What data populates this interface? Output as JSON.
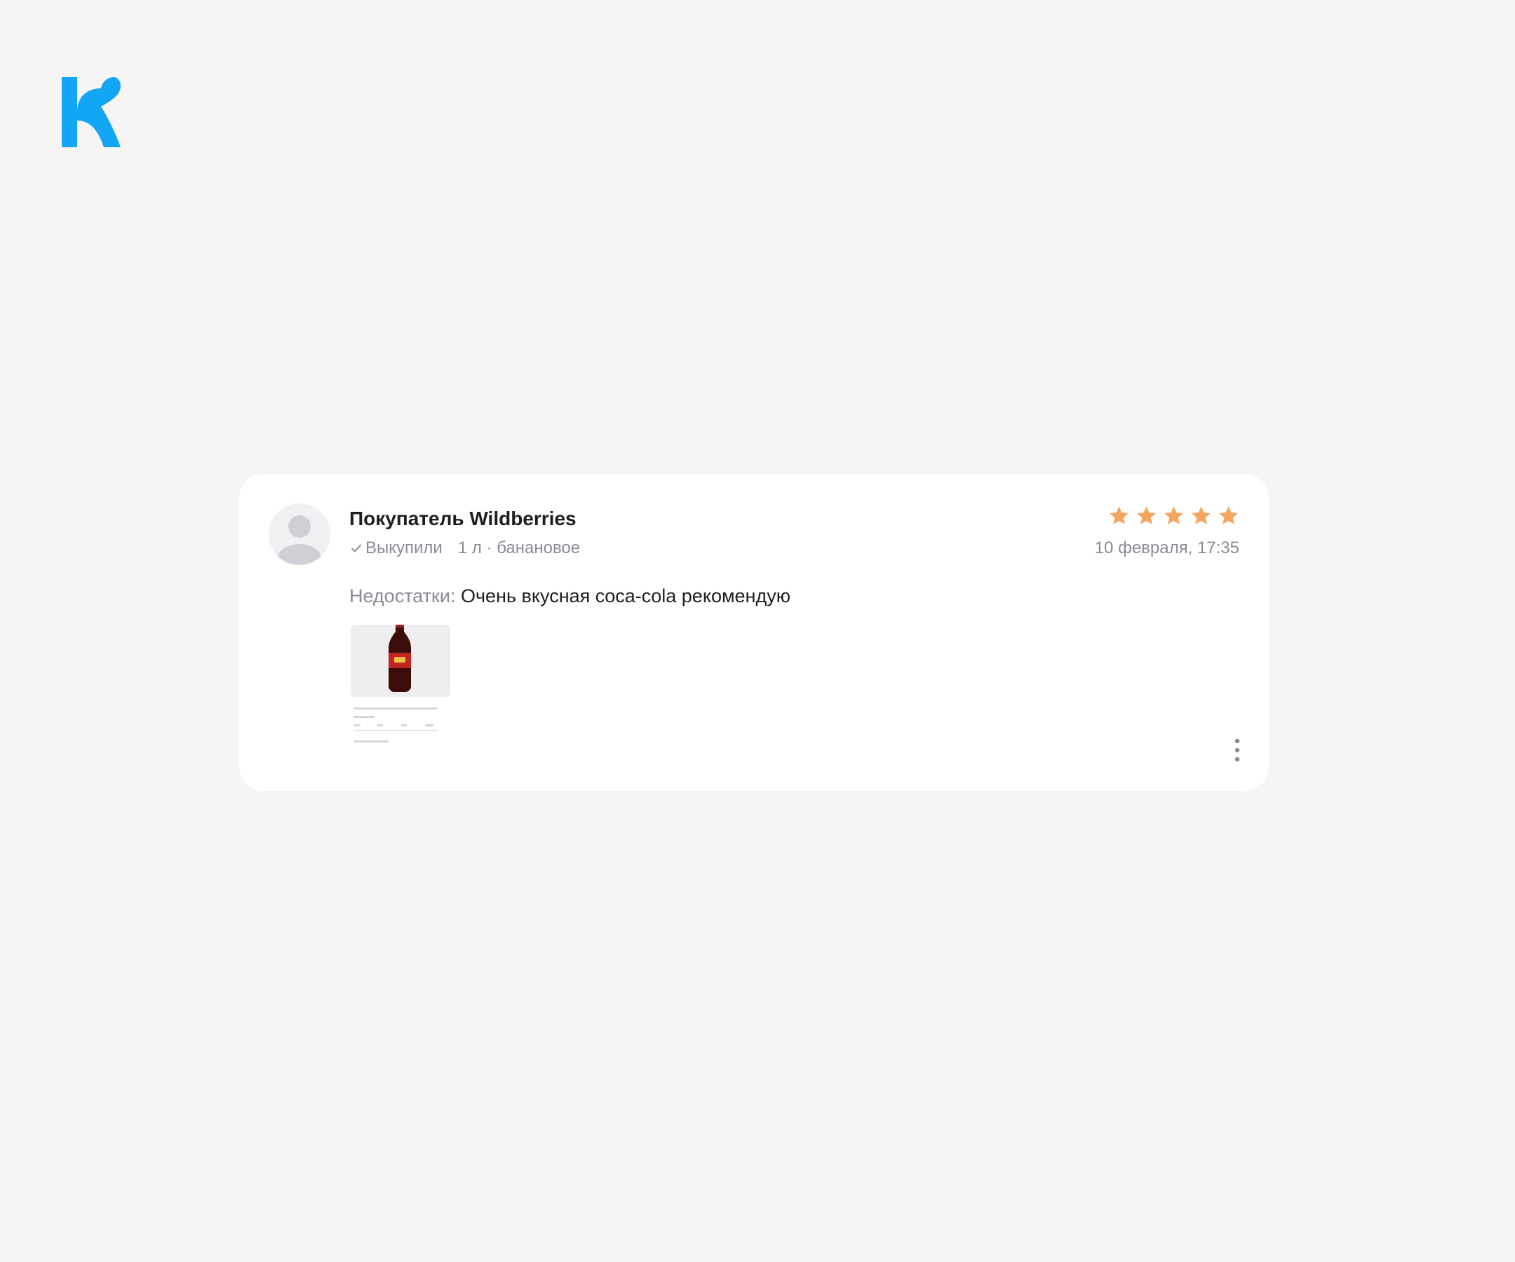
{
  "brand": {
    "logo_icon": "k-logo-icon",
    "color": "#12a6f5"
  },
  "review": {
    "author": "Покупатель Wildberries",
    "status": "Выкупили",
    "variant": "1 л · банановое",
    "rating": 5,
    "rating_max": 5,
    "star_color": "#f5a55d",
    "date": "10 февраля, 17:35",
    "label": "Недостатки:",
    "text": "Очень вкусная coca-cola рекомендую",
    "photo_icon": "cola-bottle-photo"
  },
  "colors": {
    "background": "#f6f5f4",
    "card": "#ffffff",
    "muted_text": "#8b8b94",
    "primary_text": "#1f1f1f"
  }
}
